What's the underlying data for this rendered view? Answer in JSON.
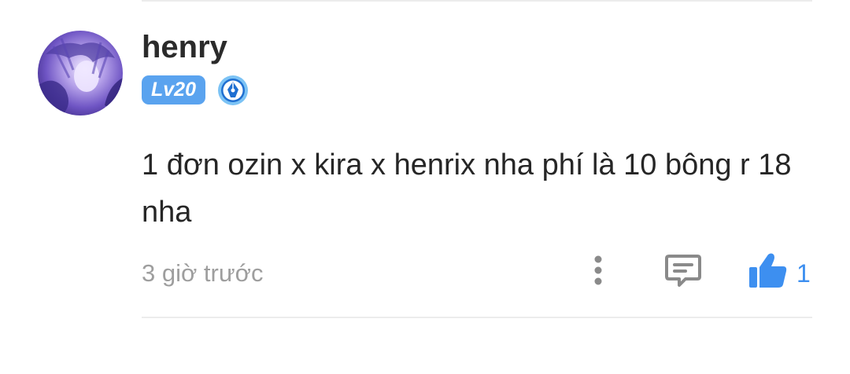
{
  "comment": {
    "author": "henry",
    "level_badge": "Lv20",
    "text": "1 đơn ozin x kira x henrix nha phí là 10 bông r 18 nha",
    "timestamp": "3 giờ trước",
    "like_count": "1"
  },
  "icons": {
    "avatar": "profile-avatar",
    "medal": "pen-medal-icon",
    "more": "more-vertical-icon",
    "reply": "comment-icon",
    "like": "thumbs-up-icon"
  },
  "colors": {
    "accent": "#3d8ff0",
    "badge_bg": "#5aa3ef",
    "username": "#2b2b2b",
    "text": "#262626",
    "muted": "#9e9e9e",
    "divider": "#ececec"
  }
}
